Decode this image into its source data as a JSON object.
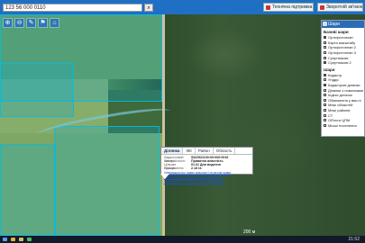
{
  "search": {
    "value": "123 56 000 0110",
    "button_label": "⌕"
  },
  "toolbar": {
    "buttons": [
      {
        "label": "Технічна підтримка"
      },
      {
        "label": "Зворотній зв'язок"
      }
    ]
  },
  "tools": [
    "⊕",
    "⊖",
    "✎",
    "⚑",
    "⌂"
  ],
  "panel": {
    "title": "Шари",
    "section1": "Базові шари",
    "base_layers": [
      {
        "label": "Ортофотоплан",
        "on": true
      },
      {
        "label": "Карта масштабу",
        "on": false
      },
      {
        "label": "Ортофотоплан 2",
        "on": false
      },
      {
        "label": "Ортофотоплан 3",
        "on": false
      },
      {
        "label": "Супутникові",
        "on": false
      },
      {
        "label": "Супутникові 2",
        "on": true
      }
    ],
    "section2": "Шари",
    "layers": [
      {
        "label": "Кадастр",
        "on": true
      },
      {
        "label": "Угіддя",
        "on": false
      },
      {
        "label": "Кадастрові ділянки",
        "on": true
      },
      {
        "label": "Ділянки з помилками",
        "on": false
      },
      {
        "label": "Індекс ділянок",
        "on": false
      },
      {
        "label": "Обмеження у вик-ні",
        "on": false
      },
      {
        "label": "Межі областей",
        "on": false
      },
      {
        "label": "Межі районів",
        "on": false
      },
      {
        "label": "СТ",
        "on": false
      },
      {
        "label": "Об'єкти ЦПМ",
        "on": false
      },
      {
        "label": "Міські поселення",
        "on": false
      }
    ]
  },
  "popup": {
    "tabs": [
      {
        "label": "Ділянка",
        "active": true
      },
      {
        "label": "ІКК",
        "active": false
      },
      {
        "label": "Район",
        "active": false
      },
      {
        "label": "Область",
        "active": false
      }
    ],
    "rows": [
      {
        "k": "Кадастровий номер:",
        "v": "5322521100:00:006:0016"
      },
      {
        "k": "Тип власності:",
        "v": "Приватна власність"
      },
      {
        "k": "Цільове призначення:",
        "v": "01.01 Для ведення"
      },
      {
        "k": "Площа:",
        "v": "2.18 га"
      }
    ],
    "links": [
      "Інформація про право власності та речові права",
      "Інформація про зареєстровані обмеження",
      "Інформація про право власності на ділянку"
    ]
  },
  "scale_text": "200 м",
  "clock": "21:52"
}
